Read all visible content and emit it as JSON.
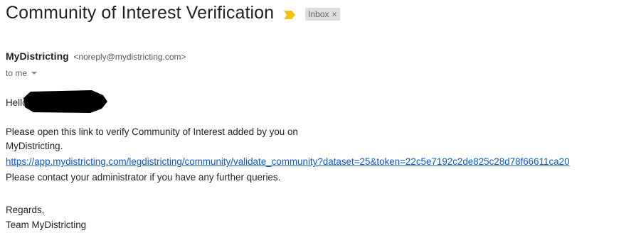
{
  "email": {
    "subject": "Community of Interest Verification",
    "label": "Inbox",
    "label_remove_glyph": "×",
    "sender_name": "MyDistricting",
    "sender_email": "<noreply@mydistricting.com>",
    "recipient": "to me",
    "greeting": "Hello",
    "body": {
      "line1": "Please open this link to verify Community of Interest added by you on",
      "line2": "MyDistricting.",
      "link": "https://app.mydistricting.com/legdistricting/community/validate_community?dataset=25&token=22c5e7192c2de825c28d78f66611ca20",
      "line4": "Please contact your administrator if you have any further queries.",
      "closing": "Regards,",
      "signature": "Team MyDistricting"
    }
  },
  "colors": {
    "importance_marker": "#f4c20d",
    "link": "#1155cc",
    "label_bg": "#dddddd",
    "redaction": "#000000"
  },
  "icons": {
    "importance": "importance-marker-icon",
    "remove": "close-icon",
    "details": "chevron-down-icon"
  }
}
